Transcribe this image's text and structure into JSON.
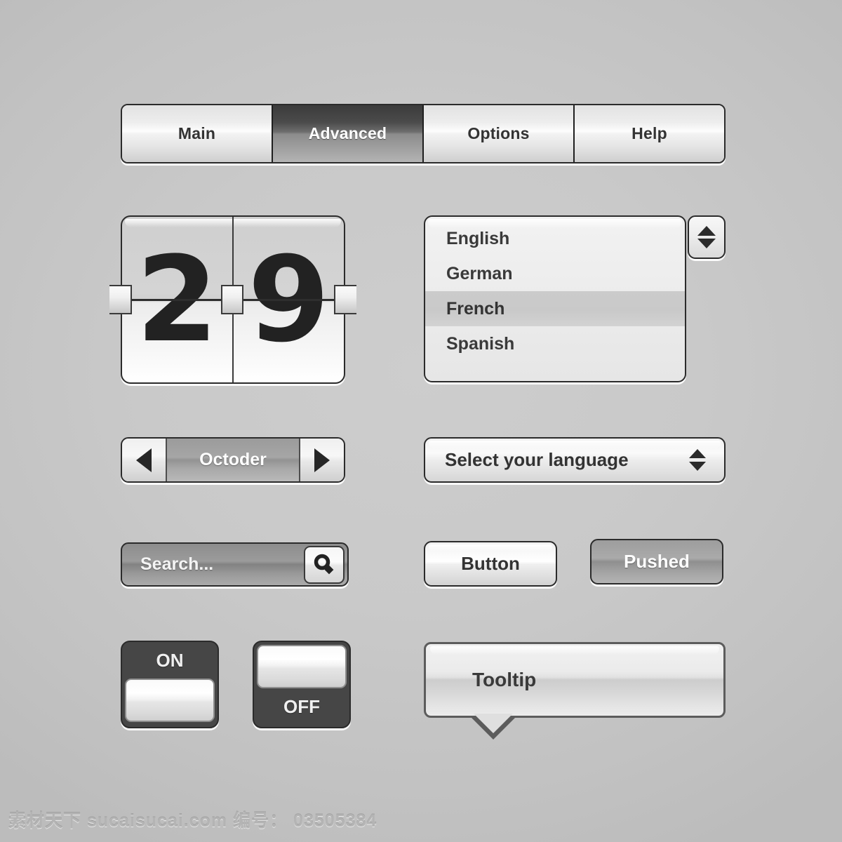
{
  "tabs": {
    "items": [
      {
        "label": "Main",
        "active": false
      },
      {
        "label": "Advanced",
        "active": true
      },
      {
        "label": "Options",
        "active": false
      },
      {
        "label": "Help",
        "active": false
      }
    ]
  },
  "flip_counter": {
    "digit_left": "2",
    "digit_right": "9",
    "value": "29"
  },
  "listbox": {
    "items": [
      {
        "label": "English",
        "selected": false
      },
      {
        "label": "German",
        "selected": false
      },
      {
        "label": "French",
        "selected": true
      },
      {
        "label": "Spanish",
        "selected": false
      }
    ],
    "spinner": {
      "up_icon": "triangle-up-icon",
      "down_icon": "triangle-down-icon"
    }
  },
  "stepper": {
    "prev_icon": "triangle-left-icon",
    "next_icon": "triangle-right-icon",
    "value": "Octoder"
  },
  "select": {
    "value": "Select your language",
    "spinner": {
      "up_icon": "triangle-up-icon",
      "down_icon": "triangle-down-icon"
    }
  },
  "search": {
    "placeholder": "Search...",
    "value": "Search...",
    "button_icon": "magnifier-icon"
  },
  "buttons": {
    "normal_label": "Button",
    "pushed_label": "Pushed"
  },
  "toggles": {
    "on_label": "ON",
    "off_label": "OFF"
  },
  "tooltip": {
    "text": "Tooltip"
  },
  "watermark": {
    "text": "素材天下 sucaisucai.com  编号： 03505384"
  },
  "colors": {
    "background": "#c9c9c9",
    "outline": "#2b2b2b",
    "text_dark": "#333333",
    "text_light": "#ffffff",
    "active_tab_dark": "#3b3b3b",
    "toggle_body": "#464646",
    "search_field": "#8d8d8d",
    "selected_row": "#cbcbcb"
  }
}
